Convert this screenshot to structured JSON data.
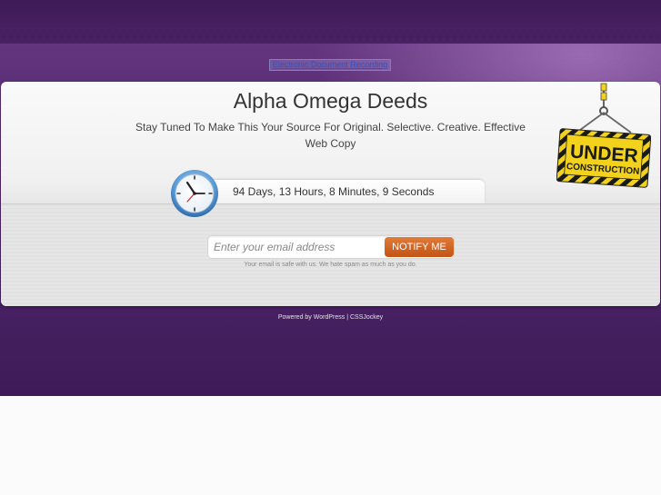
{
  "top_link": {
    "label": "Electronic Document Recording"
  },
  "site": {
    "title": "Alpha Omega Deeds",
    "tagline": "Stay Tuned To Make This Your Source For Original. Selective. Creative. Effective Web Copy"
  },
  "countdown": {
    "text": "94 Days, 13 Hours, 8 Minutes, 9 Seconds"
  },
  "signup": {
    "placeholder": "Enter your email address",
    "button_label": "NOTIFY ME",
    "note": "Your email is safe with us. We hate spam as much as you do."
  },
  "badge": {
    "line1": "UNDER",
    "line2": "CONSTRUCTION"
  },
  "footer": {
    "powered_text": "Powered by",
    "wordpress_label": "WordPress",
    "separator": "|",
    "cssjockey_label": "CSSJockey"
  },
  "colors": {
    "background": "#4d2568",
    "button": "#c35315",
    "badge_yellow": "#f2d21b"
  },
  "icons": {
    "clock": "clock-icon",
    "badge": "under-construction-sign"
  }
}
